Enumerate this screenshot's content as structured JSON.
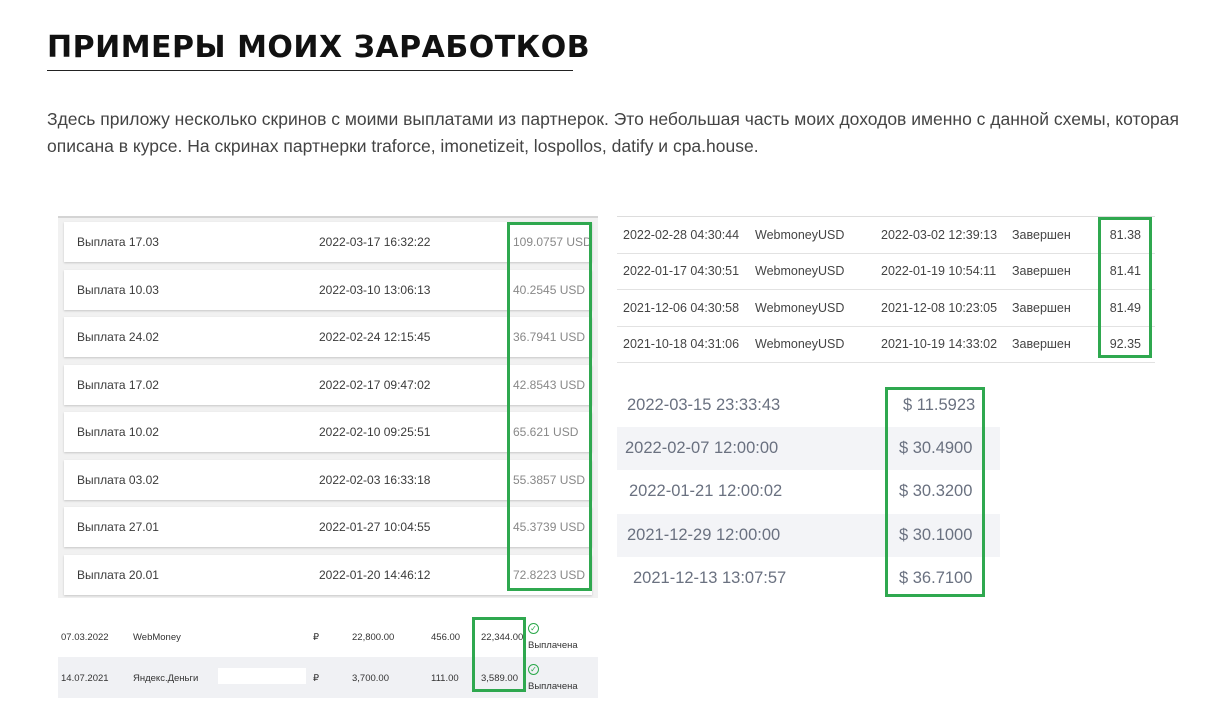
{
  "header": {
    "title": "ПРИМЕРЫ МОИХ ЗАРАБОТКОВ",
    "intro": "Здесь приложу несколько скринов с моими выплатами из партнерок. Это небольшая часть моих доходов именно с данной схемы, которая описана в курсе. На скринах партнерки traforce, imonetizeit, lospollos, datify и cpa.house."
  },
  "payouts": [
    {
      "name": "Выплата 17.03",
      "date": "2022-03-17 16:32:22",
      "amount": "109.0757 USD"
    },
    {
      "name": "Выплата 10.03",
      "date": "2022-03-10 13:06:13",
      "amount": "40.2545 USD"
    },
    {
      "name": "Выплата 24.02",
      "date": "2022-02-24 12:15:45",
      "amount": "36.7941 USD"
    },
    {
      "name": "Выплата 17.02",
      "date": "2022-02-17 09:47:02",
      "amount": "42.8543 USD"
    },
    {
      "name": "Выплата 10.02",
      "date": "2022-02-10 09:25:51",
      "amount": "65.621 USD"
    },
    {
      "name": "Выплата 03.02",
      "date": "2022-02-03 16:33:18",
      "amount": "55.3857 USD"
    },
    {
      "name": "Выплата 27.01",
      "date": "2022-01-27 10:04:55",
      "amount": "45.3739 USD"
    },
    {
      "name": "Выплата 20.01",
      "date": "2022-01-20 14:46:12",
      "amount": "72.8223 USD"
    }
  ],
  "webmoney_rows": [
    {
      "created": "2022-02-28 04:30:44",
      "system": "WebmoneyUSD",
      "paid": "2022-03-02 12:39:13",
      "status": "Завершен",
      "amount": "81.38"
    },
    {
      "created": "2022-01-17 04:30:51",
      "system": "WebmoneyUSD",
      "paid": "2022-01-19 10:54:11",
      "status": "Завершен",
      "amount": "81.41"
    },
    {
      "created": "2021-12-06 04:30:58",
      "system": "WebmoneyUSD",
      "paid": "2021-12-08 10:23:05",
      "status": "Завершен",
      "amount": "81.49"
    },
    {
      "created": "2021-10-18 04:31:06",
      "system": "WebmoneyUSD",
      "paid": "2021-10-19 14:33:02",
      "status": "Завершен",
      "amount": "92.35"
    }
  ],
  "dollar_rows": [
    {
      "date": "2022-03-15 23:33:43",
      "amount": "$ 11.5923"
    },
    {
      "date": "2022-02-07 12:00:00",
      "amount": "$ 30.4900"
    },
    {
      "date": "2022-01-21 12:00:02",
      "amount": "$ 30.3200"
    },
    {
      "date": "2021-12-29 12:00:00",
      "amount": "$ 30.1000"
    },
    {
      "date": "2021-12-13 13:07:57",
      "amount": "$ 36.7100"
    }
  ],
  "ruble_rows": [
    {
      "date": "07.03.2022",
      "system": "WebMoney",
      "currency": "₽",
      "gross": "22,800.00",
      "fee": "456.00",
      "net": "22,344.00",
      "status": "Выплачена"
    },
    {
      "date": "14.07.2021",
      "system": "Яндекс.Деньги",
      "currency": "₽",
      "gross": "3,700.00",
      "fee": "111.00",
      "net": "3,589.00",
      "status": "Выплачена"
    }
  ],
  "colors": {
    "highlight": "#2fa84f",
    "check": "#2aa84a"
  },
  "icons": {
    "status_ok": "check-circle-icon"
  }
}
